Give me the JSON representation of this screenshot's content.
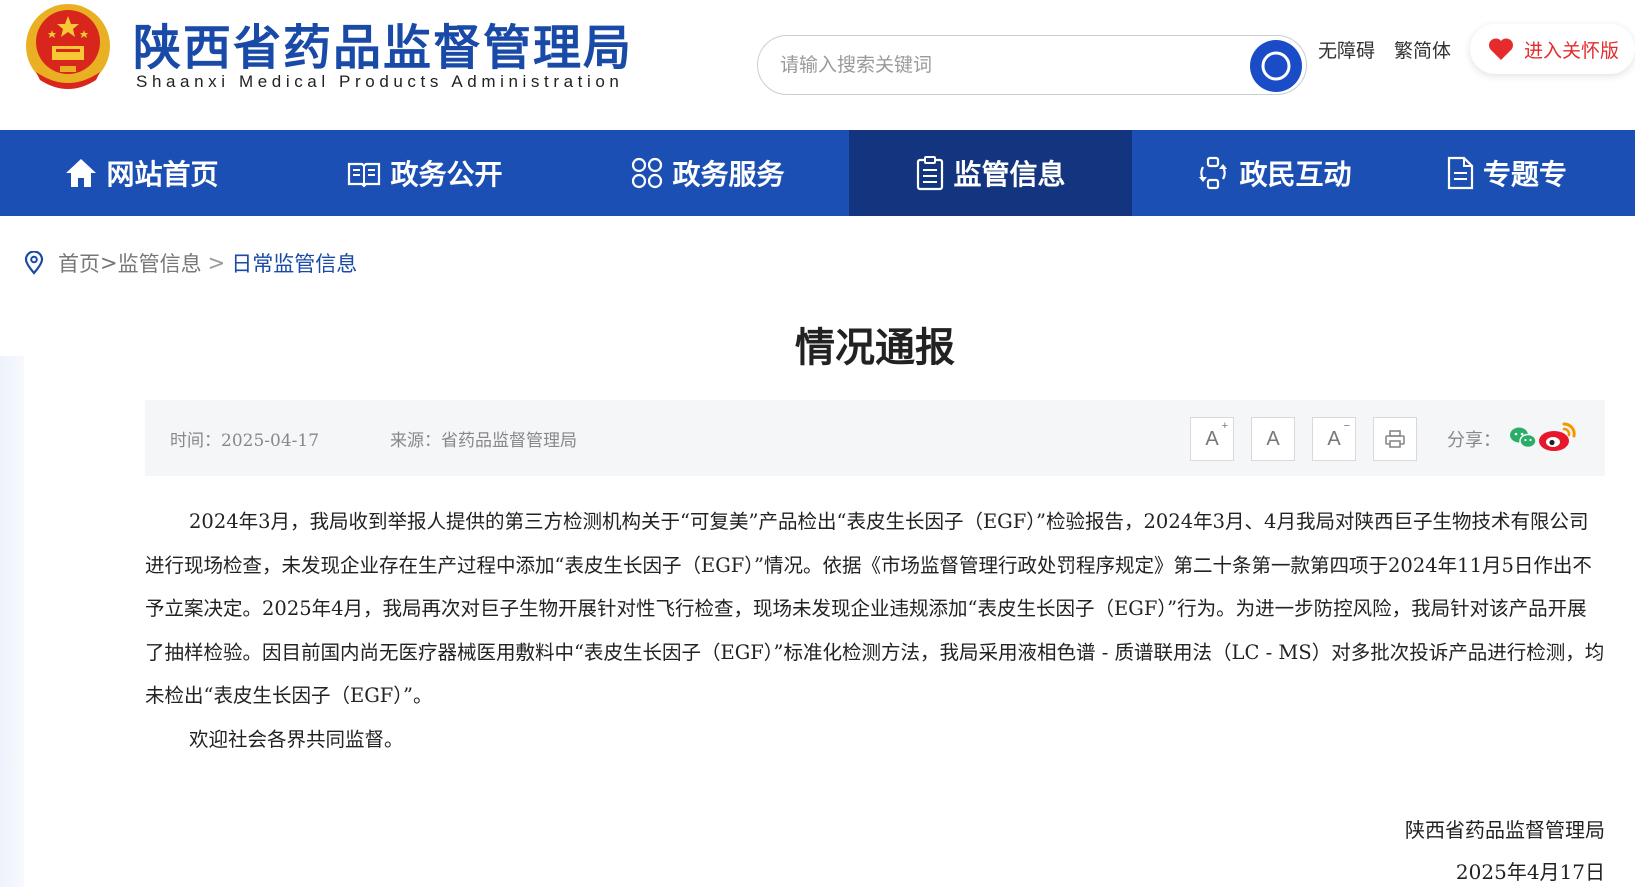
{
  "header": {
    "title": "陕西省药品监督管理局",
    "subtitle": "Shaanxi Medical Products Administration",
    "search_placeholder": "请输入搜索关键词",
    "accessibility": "无障碍",
    "traditional": "繁简体",
    "care_mode": "进入关怀版"
  },
  "nav": {
    "items": [
      {
        "label": "网站首页",
        "icon": "home-icon"
      },
      {
        "label": "政务公开",
        "icon": "book-icon"
      },
      {
        "label": "政务服务",
        "icon": "grid-icon"
      },
      {
        "label": "监管信息",
        "icon": "clipboard-icon",
        "active": true
      },
      {
        "label": "政民互动",
        "icon": "interact-icon"
      },
      {
        "label": "专题专",
        "icon": "document-icon"
      }
    ]
  },
  "breadcrumb": {
    "home": "首页",
    "sep1": ">",
    "section": "监管信息",
    "sep2": ">",
    "current": "日常监管信息"
  },
  "article": {
    "title": "情况通报",
    "time": "时间：2025-04-17",
    "source": "来源：省药品监督管理局",
    "font_large": "A",
    "font_medium": "A",
    "font_small": "A",
    "share_label": "分享：",
    "paragraph1": "2024年3月，我局收到举报人提供的第三方检测机构关于“可复美”产品检出“表皮生长因子（EGF）”检验报告，2024年3月、4月我局对陕西巨子生物技术有限公司进行现场检查，未发现企业存在生产过程中添加“表皮生长因子（EGF）”情况。依据《市场监督管理行政处罚程序规定》第二十条第一款第四项于2024年11月5日作出不予立案决定。2025年4月，我局再次对巨子生物开展针对性飞行检查，现场未发现企业违规添加“表皮生长因子（EGF）”行为。为进一步防控风险，我局针对该产品开展了抽样检验。因目前国内尚无医疗器械医用敷料中“表皮生长因子（EGF）”标准化检测方法，我局采用液相色谱 - 质谱联用法（LC - MS）对多批次投诉产品进行检测，均未检出“表皮生长因子（EGF）”。",
    "paragraph2": "欢迎社会各界共同监督。",
    "signature": "陕西省药品监督管理局",
    "date": "2025年4月17日"
  },
  "colors": {
    "brand_blue": "#1c4fb3",
    "nav_active": "#13347f",
    "care_red": "#e52b2b"
  }
}
